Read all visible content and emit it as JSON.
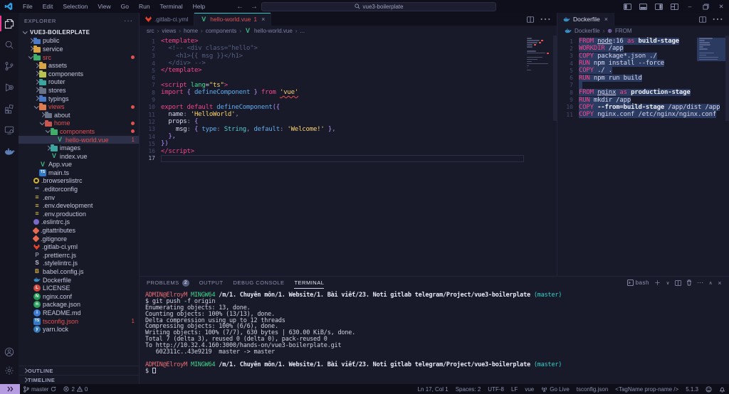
{
  "theme": {
    "accent_pink": "#ea3a92",
    "error_red": "#e05252",
    "selection_blue": "#2b3a61",
    "tab_accent": "#35c9c9",
    "remote_badge_bg": "#b59ce0"
  },
  "window": {
    "menus": [
      "File",
      "Edit",
      "Selection",
      "View",
      "Go",
      "Run",
      "Terminal",
      "Help"
    ],
    "search": "vue3-boilerplate",
    "back_arrow": "←",
    "fwd_arrow": "→"
  },
  "activity_bar": {
    "top": [
      {
        "name": "explorer",
        "active": true
      },
      {
        "name": "search"
      },
      {
        "name": "source-control"
      },
      {
        "name": "run-debug"
      },
      {
        "name": "extensions"
      },
      {
        "name": "remote-explorer"
      },
      {
        "name": "docker"
      }
    ],
    "bottom": [
      {
        "name": "account"
      },
      {
        "name": "settings"
      }
    ]
  },
  "sidebar": {
    "title": "EXPLORER",
    "more": "···",
    "outline": "OUTLINE",
    "timeline": "TIMELINE",
    "tree": [
      {
        "label": "VUE3-BOILERPLATE",
        "depth": 0,
        "chevron": "down",
        "root": true
      },
      {
        "label": "public",
        "depth": 1,
        "chevron": "right",
        "icon": "folder",
        "fc": "#4a79c6"
      },
      {
        "label": "service",
        "depth": 1,
        "chevron": "right",
        "icon": "folder",
        "fc": "#d8a542"
      },
      {
        "label": "src",
        "depth": 1,
        "chevron": "down",
        "icon": "folder",
        "fc": "#3fae6a",
        "red": true,
        "dot": true
      },
      {
        "label": "assets",
        "depth": 2,
        "chevron": "right",
        "icon": "folder",
        "fc": "#d8a542"
      },
      {
        "label": "components",
        "depth": 2,
        "chevron": "right",
        "icon": "folder",
        "fc": "#b9c24d"
      },
      {
        "label": "router",
        "depth": 2,
        "chevron": "right",
        "icon": "folder",
        "fc": "#3aa6a0"
      },
      {
        "label": "stores",
        "depth": 2,
        "chevron": "right",
        "icon": "folder",
        "fc": "#6a7287"
      },
      {
        "label": "typings",
        "depth": 2,
        "chevron": "right",
        "icon": "folder",
        "fc": "#4a79c6"
      },
      {
        "label": "views",
        "depth": 2,
        "chevron": "down",
        "icon": "folder",
        "fc": "#e07a4f",
        "red": true,
        "dot": true
      },
      {
        "label": "about",
        "depth": 3,
        "chevron": "right",
        "icon": "folder",
        "fc": "#6a7287"
      },
      {
        "label": "home",
        "depth": 3,
        "chevron": "down",
        "icon": "folder",
        "fc": "#c9564f",
        "red": true,
        "dot": true
      },
      {
        "label": "components",
        "depth": 4,
        "chevron": "down",
        "icon": "folder",
        "fc": "#3fae6a",
        "red": true,
        "dot": true
      },
      {
        "label": "hello-world.vue",
        "depth": 5,
        "icon": "vue",
        "red": true,
        "selected": true,
        "badge": "1"
      },
      {
        "label": "images",
        "depth": 4,
        "chevron": "right",
        "icon": "folder",
        "fc": "#3aa6a0"
      },
      {
        "label": "index.vue",
        "depth": 4,
        "icon": "vue"
      },
      {
        "label": "App.vue",
        "depth": 2,
        "icon": "vue"
      },
      {
        "label": "main.ts",
        "depth": 2,
        "icon": "ts"
      },
      {
        "label": ".browserslistrc",
        "depth": 1,
        "icon": "ring-yellow"
      },
      {
        "label": ".editorconfig",
        "depth": 1,
        "icon": "editorconfig"
      },
      {
        "label": ".env",
        "depth": 1,
        "icon": "env"
      },
      {
        "label": ".env.development",
        "depth": 1,
        "icon": "env"
      },
      {
        "label": ".env.production",
        "depth": 1,
        "icon": "env"
      },
      {
        "label": ".eslintrc.js",
        "depth": 1,
        "icon": "eslint"
      },
      {
        "label": ".gitattributes",
        "depth": 1,
        "icon": "git"
      },
      {
        "label": ".gitignore",
        "depth": 1,
        "icon": "git"
      },
      {
        "label": ".gitlab-ci.yml",
        "depth": 1,
        "icon": "gitlab"
      },
      {
        "label": ".prettierrc.js",
        "depth": 1,
        "icon": "prettier"
      },
      {
        "label": ".stylelintrc.js",
        "depth": 1,
        "icon": "stylelint"
      },
      {
        "label": "babel.config.js",
        "depth": 1,
        "icon": "babel"
      },
      {
        "label": "Dockerfile",
        "depth": 1,
        "icon": "docker-file"
      },
      {
        "label": "LICENSE",
        "depth": 1,
        "icon": "license"
      },
      {
        "label": "nginx.conf",
        "depth": 1,
        "icon": "nginx"
      },
      {
        "label": "package.json",
        "depth": 1,
        "icon": "npm"
      },
      {
        "label": "README.md",
        "depth": 1,
        "icon": "readme"
      },
      {
        "label": "tsconfig.json",
        "depth": 1,
        "icon": "ts",
        "red": true,
        "badge": "1"
      },
      {
        "label": "yarn.lock",
        "depth": 1,
        "icon": "yarn"
      }
    ]
  },
  "editor_left": {
    "tabs": [
      {
        "label": ".gitlab-ci.yml",
        "icon": "gitlab",
        "active": false
      },
      {
        "label": "hello-world.vue",
        "icon": "vue",
        "active": true,
        "focused": true,
        "red": true,
        "badge": "1",
        "close": "×"
      }
    ],
    "breadcrumb": [
      "src",
      "views",
      "home",
      "components",
      "hello-world.vue",
      "..."
    ],
    "breadcrumb_file_icon": "vue",
    "active_line": 17,
    "minimap_error_marks": [
      1,
      2,
      3,
      7
    ],
    "lines": [
      {
        "t": [
          [
            "<template>",
            "k"
          ]
        ]
      },
      {
        "t": [
          [
            "  ",
            "d"
          ],
          [
            "<!-- <div class=\"hello\">",
            "c"
          ]
        ]
      },
      {
        "t": [
          [
            "    ",
            "d"
          ],
          [
            "<h1>{{ msg }}</h1>",
            "c"
          ]
        ]
      },
      {
        "t": [
          [
            "  ",
            "d"
          ],
          [
            "</div> -->",
            "c"
          ]
        ]
      },
      {
        "t": [
          [
            "</template>",
            "k"
          ]
        ]
      },
      {
        "t": []
      },
      {
        "t": [
          [
            "<script",
            "k"
          ],
          [
            " ",
            "d"
          ],
          [
            "lang",
            "a"
          ],
          [
            "=",
            "d"
          ],
          [
            "\"ts\"",
            "s"
          ],
          [
            ">",
            "k"
          ]
        ]
      },
      {
        "t": [
          [
            "import",
            "k"
          ],
          [
            " ",
            "d"
          ],
          [
            "{",
            "p"
          ],
          [
            " ",
            "d"
          ],
          [
            "defineComponent",
            "f"
          ],
          [
            " ",
            "d"
          ],
          [
            "}",
            "p"
          ],
          [
            " ",
            "d"
          ],
          [
            "from",
            "k"
          ],
          [
            " ",
            "d"
          ],
          [
            "'vue'",
            "s err"
          ]
        ]
      },
      {
        "t": []
      },
      {
        "t": [
          [
            "export",
            "k"
          ],
          [
            " ",
            "d"
          ],
          [
            "default",
            "k"
          ],
          [
            " ",
            "d"
          ],
          [
            "defineComponent",
            "f"
          ],
          [
            "({",
            "p"
          ]
        ]
      },
      {
        "t": [
          [
            "  name",
            "d"
          ],
          [
            ":",
            "g"
          ],
          [
            " ",
            "d"
          ],
          [
            "'HelloWorld'",
            "s"
          ],
          [
            ",",
            "g"
          ]
        ]
      },
      {
        "t": [
          [
            "  props",
            "d"
          ],
          [
            ":",
            "g"
          ],
          [
            " {",
            "p"
          ]
        ]
      },
      {
        "t": [
          [
            "    msg",
            "d"
          ],
          [
            ":",
            "g"
          ],
          [
            " ",
            "d"
          ],
          [
            "{",
            "p"
          ],
          [
            " ",
            "d"
          ],
          [
            "type",
            "f"
          ],
          [
            ":",
            "g"
          ],
          [
            " ",
            "d"
          ],
          [
            "String",
            "t"
          ],
          [
            ",",
            "g"
          ],
          [
            " ",
            "d"
          ],
          [
            "default",
            "f"
          ],
          [
            ":",
            "g"
          ],
          [
            " ",
            "d"
          ],
          [
            "'Welcome!'",
            "s"
          ],
          [
            " ",
            "d"
          ],
          [
            "}",
            "p"
          ],
          [
            ",",
            "g"
          ]
        ]
      },
      {
        "t": [
          [
            "  },",
            "p"
          ]
        ]
      },
      {
        "t": [
          [
            "})",
            "p"
          ]
        ]
      },
      {
        "t": [
          [
            "</script>",
            "k"
          ]
        ]
      },
      {
        "t": [],
        "cursor": true
      }
    ]
  },
  "editor_right": {
    "tabs": [
      {
        "label": "Dockerfile",
        "icon": "docker-file",
        "active": true,
        "close": "×"
      }
    ],
    "breadcrumb": [
      "Dockerfile",
      "FROM"
    ],
    "breadcrumb_file_icon": "docker-file",
    "breadcrumb_symbol": "⊕",
    "all_selected": true,
    "lines": [
      {
        "t": [
          [
            "FROM",
            "k"
          ],
          [
            " ",
            "d"
          ],
          [
            "node",
            "u"
          ],
          [
            ":16 ",
            "d"
          ],
          [
            "as",
            "k"
          ],
          [
            " ",
            "d"
          ],
          [
            "build-stage",
            "b"
          ]
        ]
      },
      {
        "t": [
          [
            "WORKDIR",
            "k"
          ],
          [
            " /app",
            "d"
          ]
        ]
      },
      {
        "t": [
          [
            "COPY",
            "k"
          ],
          [
            " package*.json ./",
            "d"
          ]
        ]
      },
      {
        "t": [
          [
            "RUN",
            "k"
          ],
          [
            " npm install --force",
            "d"
          ]
        ]
      },
      {
        "t": [
          [
            "COPY",
            "k"
          ],
          [
            " ./ .",
            "d"
          ]
        ]
      },
      {
        "t": [
          [
            "RUN",
            "k"
          ],
          [
            " npm run build",
            "d"
          ]
        ]
      },
      {
        "t": []
      },
      {
        "t": [
          [
            "FROM",
            "k"
          ],
          [
            " ",
            "d"
          ],
          [
            "nginx",
            "u"
          ],
          [
            " ",
            "d"
          ],
          [
            "as",
            "k"
          ],
          [
            " ",
            "d"
          ],
          [
            "production-stage",
            "b"
          ]
        ]
      },
      {
        "t": [
          [
            "RUN",
            "k"
          ],
          [
            " mkdir /app",
            "d"
          ]
        ]
      },
      {
        "t": [
          [
            "COPY",
            "k"
          ],
          [
            " ",
            "d"
          ],
          [
            "--from=build-stage",
            "b"
          ],
          [
            " /app/dist /app",
            "d"
          ]
        ]
      },
      {
        "t": [
          [
            "COPY",
            "k"
          ],
          [
            " nginx.conf /etc/nginx/nginx.conf",
            "d"
          ]
        ]
      }
    ]
  },
  "panel": {
    "tabs": [
      {
        "label": "PROBLEMS",
        "badge": "2"
      },
      {
        "label": "OUTPUT"
      },
      {
        "label": "DEBUG CONSOLE"
      },
      {
        "label": "TERMINAL",
        "active": true
      }
    ],
    "shell": "bash",
    "terminal_lines": [
      {
        "t": [
          [
            "ADMIN@ElroyM ",
            "u"
          ],
          [
            "MINGW64 ",
            "h"
          ],
          [
            "/m/1. Chuyên môn/1. Website/1. Bài viết/23. Noti gitlab telegram/Project/vue3-boilerplate ",
            "pa"
          ],
          [
            "(master)",
            "br"
          ]
        ]
      },
      {
        "t": [
          [
            "$ git push -f origin",
            "d"
          ]
        ]
      },
      {
        "t": [
          [
            "Enumerating objects: 13, done.",
            "d"
          ]
        ]
      },
      {
        "t": [
          [
            "Counting objects: 100% (13/13), done.",
            "d"
          ]
        ]
      },
      {
        "t": [
          [
            "Delta compression using up to 12 threads",
            "d"
          ]
        ]
      },
      {
        "t": [
          [
            "Compressing objects: 100% (6/6), done.",
            "d"
          ]
        ]
      },
      {
        "t": [
          [
            "Writing objects: 100% (7/7), 630 bytes | 630.00 KiB/s, done.",
            "d"
          ]
        ]
      },
      {
        "t": [
          [
            "Total 7 (delta 3), reused 0 (delta 0), pack-reused 0",
            "d"
          ]
        ]
      },
      {
        "t": [
          [
            "To http://10.32.4.160:3000/hands-on/vue3-boilerplate.git",
            "d"
          ]
        ]
      },
      {
        "t": [
          [
            "   602311c..43e9219  master -> master",
            "d"
          ]
        ]
      },
      {
        "t": []
      },
      {
        "t": [
          [
            "ADMIN@ElroyM ",
            "u"
          ],
          [
            "MINGW64 ",
            "h"
          ],
          [
            "/m/1. Chuyên môn/1. Website/1. Bài viết/23. Noti gitlab telegram/Project/vue3-boilerplate ",
            "pa"
          ],
          [
            "(master)",
            "br"
          ]
        ]
      },
      {
        "t": [
          [
            "$ ",
            "d"
          ]
        ],
        "cursor": true
      }
    ]
  },
  "status_bar": {
    "branch": "master",
    "errors": "2",
    "warnings": "0",
    "right": [
      {
        "label": "Ln 17, Col 1",
        "name": "cursor-position"
      },
      {
        "label": "Spaces: 2",
        "name": "indentation"
      },
      {
        "label": "UTF-8",
        "name": "encoding"
      },
      {
        "label": "LF",
        "name": "eol"
      },
      {
        "label": "vue",
        "name": "language-mode"
      },
      {
        "label": "Go Live",
        "icon": "broadcast",
        "name": "go-live"
      },
      {
        "label": "tsconfig.json",
        "name": "tsconfig"
      },
      {
        "label": "<TagName prop-name />",
        "name": "tag-template"
      },
      {
        "label": "5.1.3",
        "name": "version"
      },
      {
        "icon": "smiley",
        "name": "feedback"
      },
      {
        "icon": "bell",
        "name": "notifications"
      }
    ]
  }
}
